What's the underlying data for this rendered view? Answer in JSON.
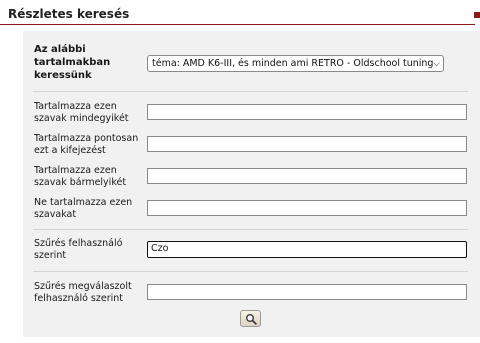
{
  "header": {
    "title": "Részletes keresés"
  },
  "form": {
    "scope_label": "Az alábbi tartalmakban keressünk",
    "scope_value": "téma: AMD K6-III, és minden ami RETRO - Oldschool tuning",
    "all_words_label": "Tartalmazza ezen szavak mindegyikét",
    "all_words_value": "",
    "exact_phrase_label": "Tartalmazza pontosan ezt a kifejezést",
    "exact_phrase_value": "",
    "any_words_label": "Tartalmazza ezen szavak bármelyikét",
    "any_words_value": "",
    "none_words_label": "Ne tartalmazza ezen szavakat",
    "none_words_value": "",
    "user_filter_label": "Szűrés felhasználó szerint",
    "user_filter_value": "Czo",
    "replied_user_label": "Szűrés megválaszolt felhasználó szerint",
    "replied_user_value": ""
  },
  "icons": {
    "search": "magnifier-icon",
    "dropdown": "chevron-down-icon"
  },
  "colors": {
    "accent": "#8b1a1a",
    "panel": "#f1f1f1"
  }
}
